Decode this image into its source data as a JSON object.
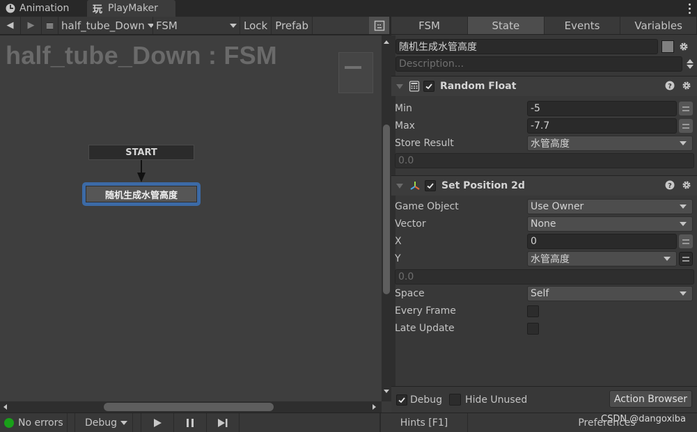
{
  "window_tabs": [
    {
      "label": "Animation",
      "icon": "clock-icon"
    },
    {
      "label": "PlayMaker",
      "icon": "playmaker-icon",
      "active": true
    }
  ],
  "toolbar": {
    "back_icon": "◀",
    "forward_icon": "▶",
    "menu_icon": "≡",
    "gameobject_select": "half_tube_Down",
    "fsm_select": "FSM",
    "lock_label": "Lock",
    "prefab_label": "Prefab"
  },
  "canvas": {
    "title": "half_tube_Down : FSM",
    "start_node": "START",
    "state_node": "随机生成水管高度"
  },
  "statusbar": {
    "errors": "No errors",
    "debug_label": "Debug",
    "hints": "Hints [F1]",
    "preferences": "Preferences",
    "error_status_color": "#19a019"
  },
  "watermark": "CSDN @dangoxiba",
  "inspector": {
    "tabs": [
      {
        "label": "FSM"
      },
      {
        "label": "State",
        "active": true
      },
      {
        "label": "Events"
      },
      {
        "label": "Variables"
      }
    ],
    "state_name": "随机生成水管高度",
    "description_placeholder": "Description...",
    "actions": [
      {
        "title": "Random Float",
        "icon": "calculator-icon",
        "enabled": true,
        "props": {
          "min_label": "Min",
          "min_value": "-5",
          "max_label": "Max",
          "max_value": "-7.7",
          "store_label": "Store Result",
          "store_value": "水管高度",
          "readout": "0.0"
        }
      },
      {
        "title": "Set Position 2d",
        "icon": "transform-axes-icon",
        "enabled": true,
        "props": {
          "gameobject_label": "Game Object",
          "gameobject_value": "Use Owner",
          "vector_label": "Vector",
          "vector_value": "None",
          "x_label": "X",
          "x_value": "0",
          "y_label": "Y",
          "y_value": "水管高度",
          "readout": "0.0",
          "space_label": "Space",
          "space_value": "Self",
          "everyframe_label": "Every Frame",
          "everyframe_checked": false,
          "lateupdate_label": "Late Update",
          "lateupdate_checked": false
        }
      }
    ],
    "footer": {
      "debug_label": "Debug",
      "debug_checked": true,
      "hide_unused_label": "Hide Unused",
      "hide_unused_checked": false,
      "action_browser_label": "Action Browser"
    }
  }
}
